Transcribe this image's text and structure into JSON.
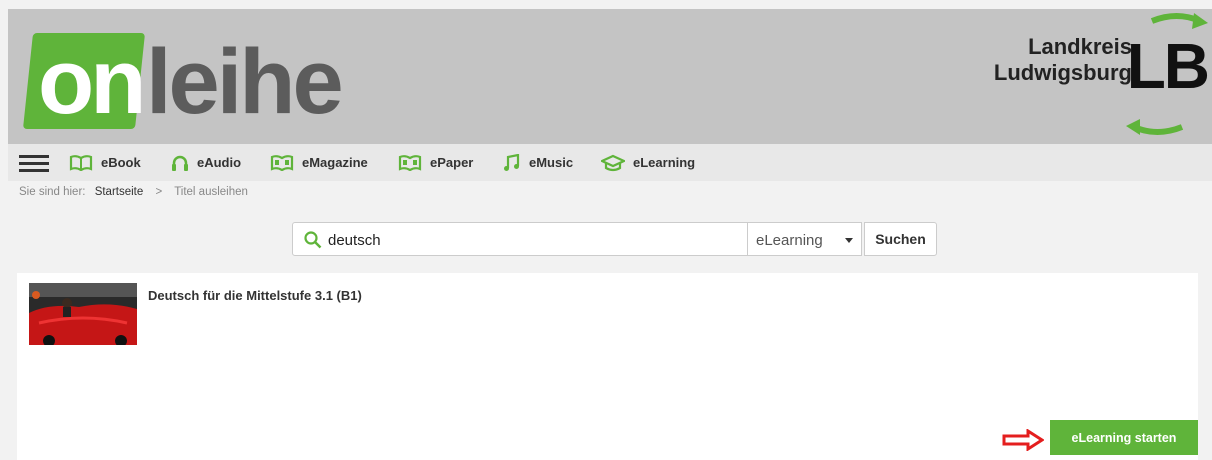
{
  "brand": {
    "logo_on": "on",
    "logo_leihe": "leihe",
    "lb_line1": "Landkreis",
    "lb_line2": "Ludwigsburg",
    "lb_letters": "LB"
  },
  "nav": {
    "items": [
      {
        "label": "eBook",
        "icon": "open-book-icon"
      },
      {
        "label": "eAudio",
        "icon": "headphones-icon"
      },
      {
        "label": "eMagazine",
        "icon": "magazine-icon"
      },
      {
        "label": "ePaper",
        "icon": "newspaper-icon"
      },
      {
        "label": "eMusic",
        "icon": "music-note-icon"
      },
      {
        "label": "eLearning",
        "icon": "graduation-cap-icon"
      }
    ]
  },
  "breadcrumb": {
    "prefix": "Sie sind hier:",
    "home": "Startseite",
    "separator": ">",
    "current": "Titel ausleihen"
  },
  "search": {
    "value": "deutsch",
    "category": "eLearning",
    "button": "Suchen"
  },
  "result": {
    "title": "Deutsch für die Mittelstufe 3.1 (B1)",
    "action": "eLearning starten"
  },
  "colors": {
    "accent": "#5fb43a",
    "header_bg": "#c4c4c4",
    "arrow": "#e41e1e"
  }
}
